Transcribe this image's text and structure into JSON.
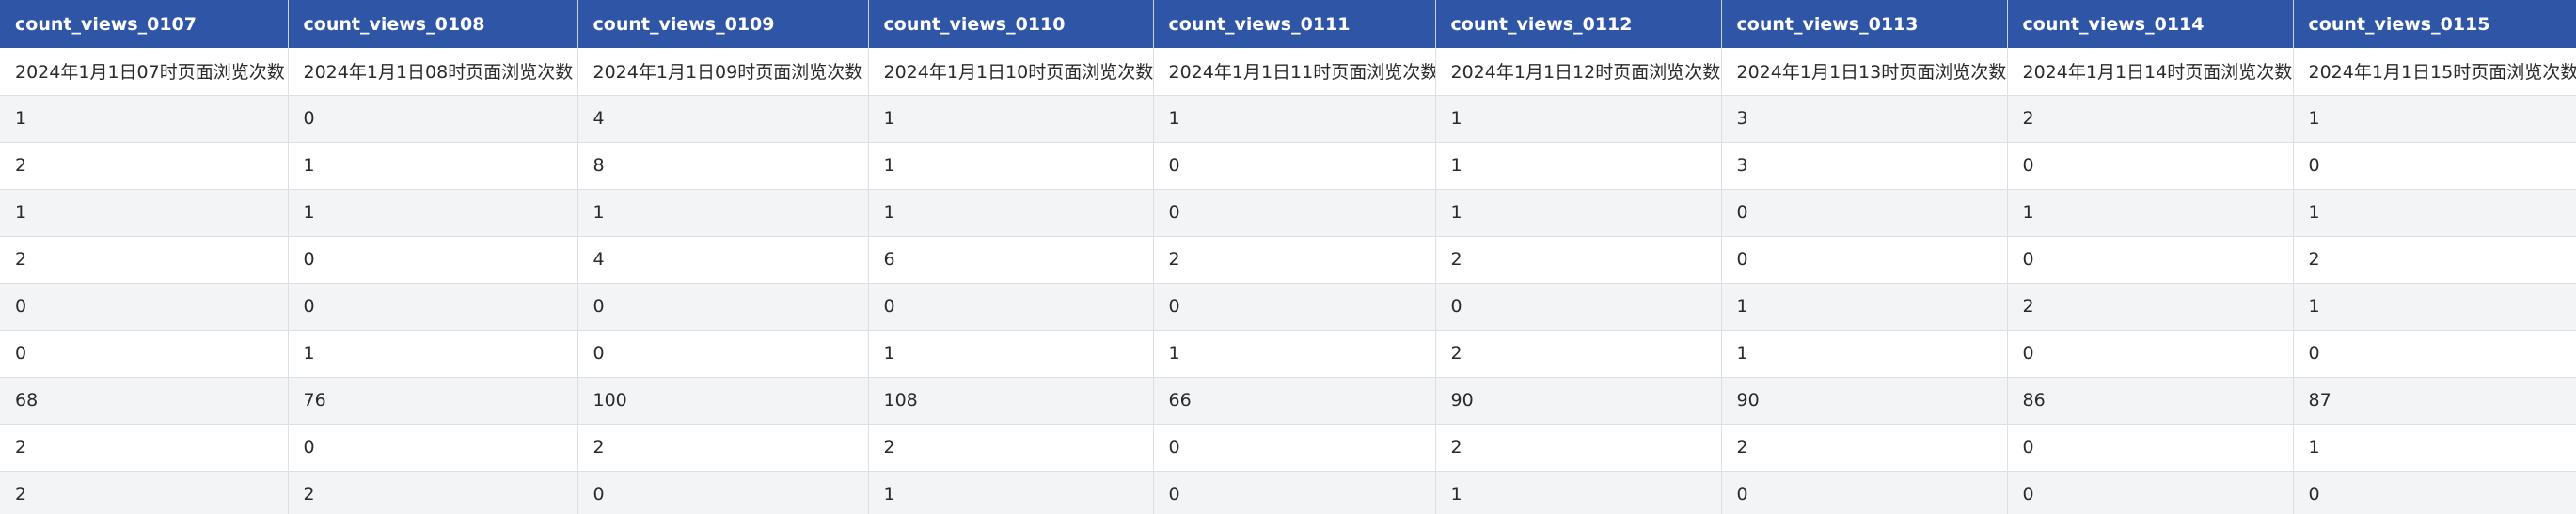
{
  "table": {
    "columns": [
      "count_views_0107",
      "count_views_0108",
      "count_views_0109",
      "count_views_0110",
      "count_views_0111",
      "count_views_0112",
      "count_views_0113",
      "count_views_0114",
      "count_views_0115"
    ],
    "descriptions": [
      "2024年1月1日07时页面浏览次数",
      "2024年1月1日08时页面浏览次数",
      "2024年1月1日09时页面浏览次数",
      "2024年1月1日10时页面浏览次数",
      "2024年1月1日11时页面浏览次数",
      "2024年1月1日12时页面浏览次数",
      "2024年1月1日13时页面浏览次数",
      "2024年1月1日14时页面浏览次数",
      "2024年1月1日15时页面浏览次数"
    ],
    "rows": [
      [
        "1",
        "0",
        "4",
        "1",
        "1",
        "1",
        "3",
        "2",
        "1"
      ],
      [
        "2",
        "1",
        "8",
        "1",
        "0",
        "1",
        "3",
        "0",
        "0"
      ],
      [
        "1",
        "1",
        "1",
        "1",
        "0",
        "1",
        "0",
        "1",
        "1"
      ],
      [
        "2",
        "0",
        "4",
        "6",
        "2",
        "2",
        "0",
        "0",
        "2"
      ],
      [
        "0",
        "0",
        "0",
        "0",
        "0",
        "0",
        "1",
        "2",
        "1"
      ],
      [
        "0",
        "1",
        "0",
        "1",
        "1",
        "2",
        "1",
        "0",
        "0"
      ],
      [
        "68",
        "76",
        "100",
        "108",
        "66",
        "90",
        "90",
        "86",
        "87"
      ],
      [
        "2",
        "0",
        "2",
        "2",
        "0",
        "2",
        "2",
        "0",
        "1"
      ],
      [
        "2",
        "2",
        "0",
        "1",
        "0",
        "1",
        "0",
        "0",
        "0"
      ]
    ]
  },
  "colors": {
    "header_background": "#2f56a6",
    "header_text": "#ffffff",
    "stripe_background": "#f3f4f6",
    "grid_line": "#dcdfe5"
  }
}
